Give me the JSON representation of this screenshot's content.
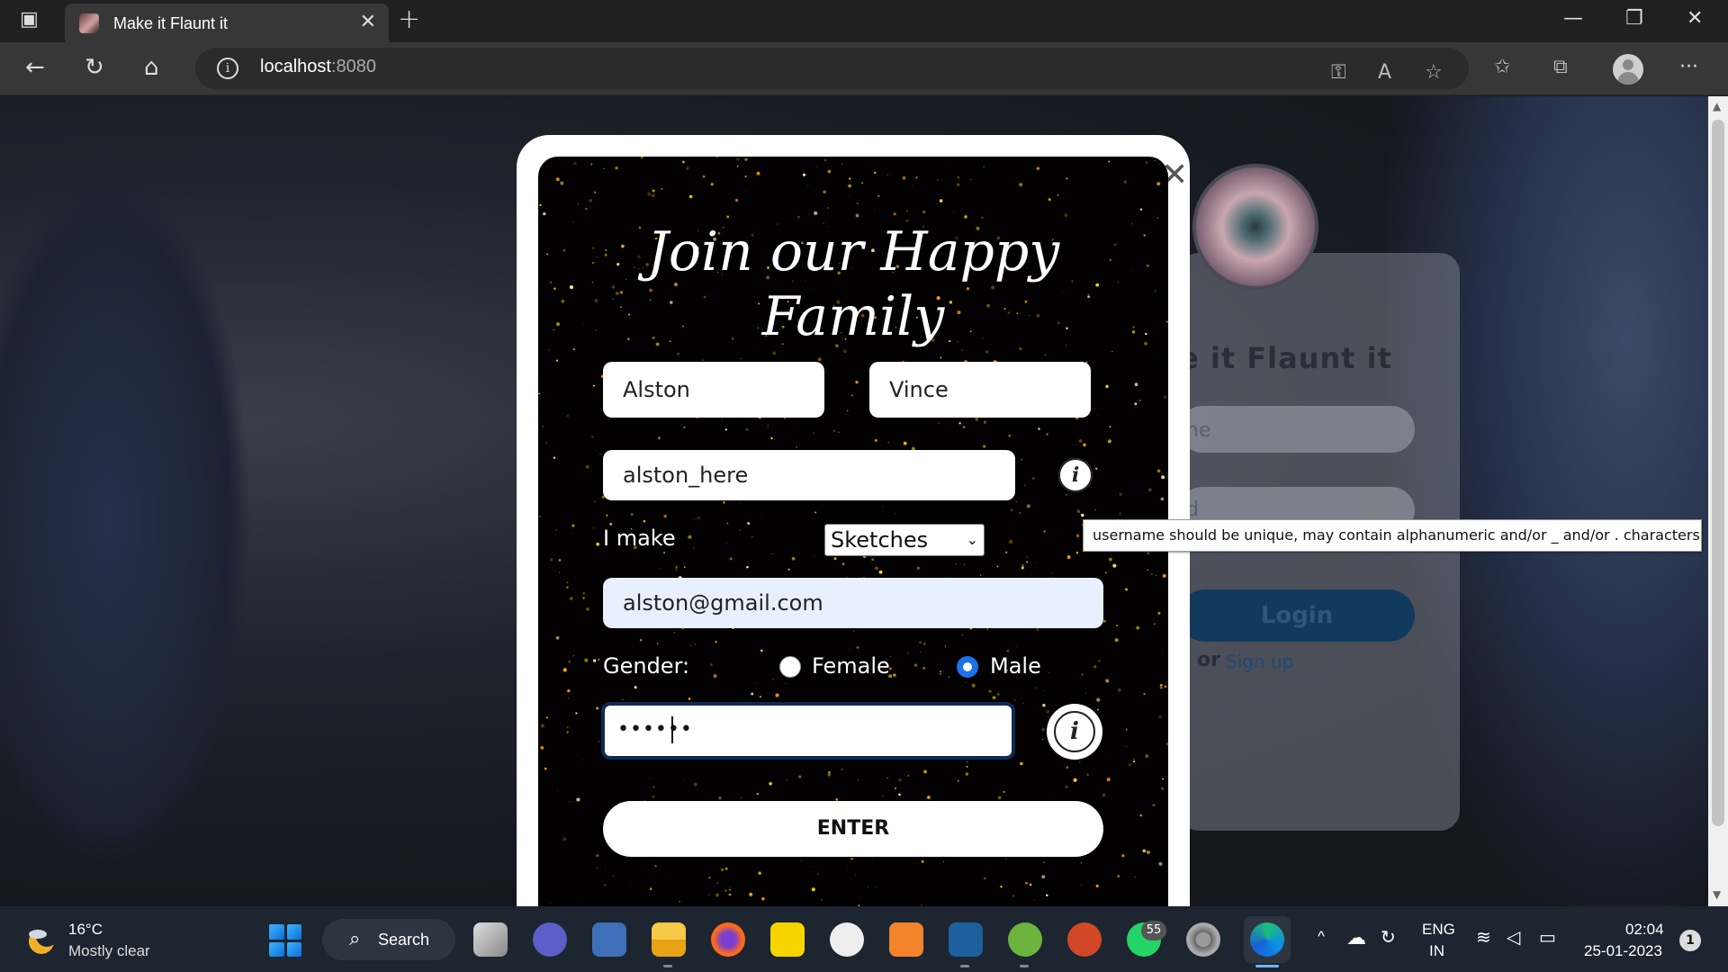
{
  "browser": {
    "tab_title": "Make it Flaunt it",
    "tab_close": "✕",
    "new_tab": "+",
    "address_host": "localhost",
    "address_port": ":8080",
    "controls": {
      "minimize": "—",
      "restore": "❐",
      "close": "✕"
    }
  },
  "background_page": {
    "title": "e it Flaunt it",
    "username_placeholder": "ne",
    "password_placeholder": "d",
    "login_label": "Login",
    "or_text": "or",
    "signup_link": "Sign up"
  },
  "modal": {
    "close_icon": "✕",
    "title_line1": "Join our Happy",
    "title_line2": "Family",
    "first_name": "Alston",
    "last_name": "Vince",
    "username": "alston_here",
    "make_label": "I make",
    "make_selected": "Sketches",
    "email": "alston@gmail.com",
    "gender_label": "Gender:",
    "gender_options": [
      {
        "label": "Female",
        "checked": false
      },
      {
        "label": "Male",
        "checked": true
      }
    ],
    "password_masked": "••••••",
    "enter_label": "ENTER",
    "info_glyph": "i"
  },
  "tooltip": {
    "text": "username should be unique, may contain alphanumeric and/or _ and/or . characters"
  },
  "taskbar": {
    "weather_temp": "16°C",
    "weather_desc": "Mostly clear",
    "search_label": "Search",
    "whatsapp_badge": "55",
    "lang_line1": "ENG",
    "lang_line2": "IN",
    "time": "02:04",
    "date": "25-01-2023",
    "notification_count": "1"
  },
  "colors": {
    "accent_blue": "#1a73e8",
    "modal_bg": "#020000",
    "taskbar_bg": "#1d2530"
  }
}
